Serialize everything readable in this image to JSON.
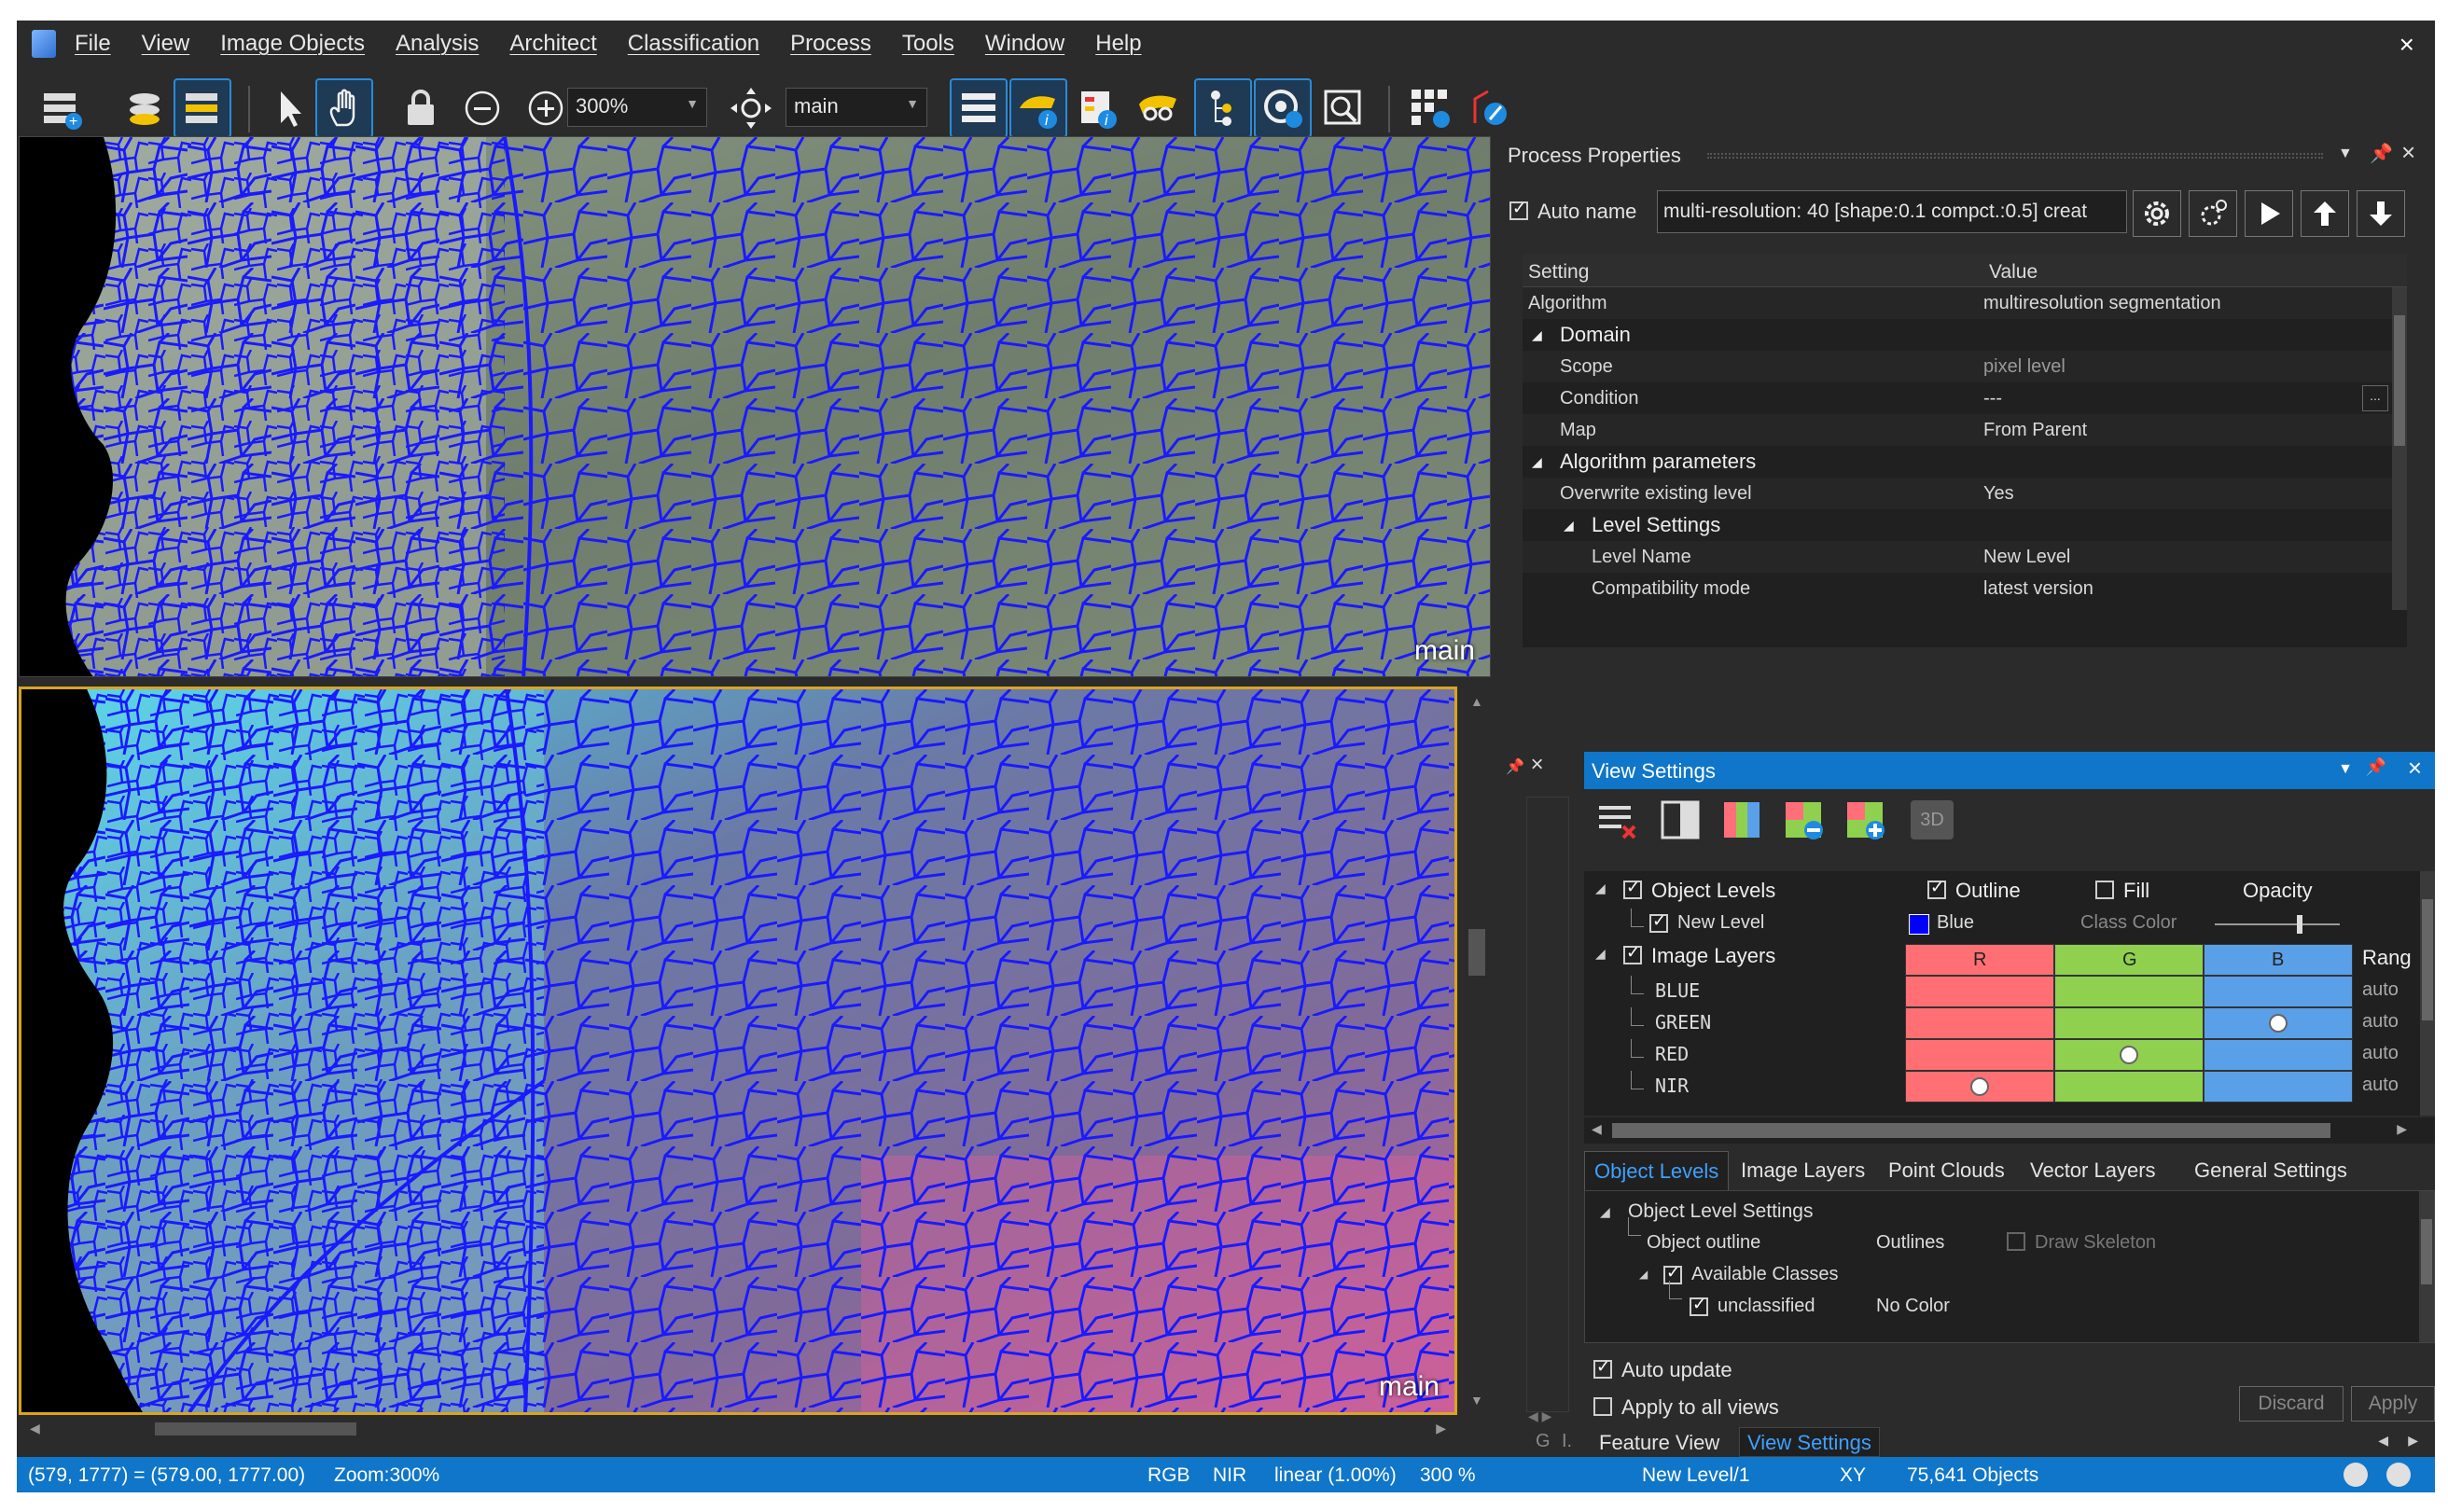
{
  "menu": [
    "File",
    "View",
    "Image Objects",
    "Analysis",
    "Architect",
    "Classification",
    "Process",
    "Tools",
    "Window",
    "Help"
  ],
  "window_close": "×",
  "toolbar": {
    "zoom": "300%",
    "map": "main"
  },
  "views": {
    "top_label": "main",
    "bottom_label": "main"
  },
  "process_properties": {
    "title": "Process Properties",
    "auto_name_label": "Auto name",
    "auto_name_checked": true,
    "name_value": "multi-resolution: 40 [shape:0.1 compct.:0.5] creat",
    "headers": [
      "Setting",
      "Value"
    ],
    "rows": [
      {
        "setting": "Algorithm",
        "value": "multiresolution segmentation"
      },
      {
        "setting": "Domain",
        "value": ""
      },
      {
        "setting": "Scope",
        "value": "pixel level"
      },
      {
        "setting": "Condition",
        "value": "---"
      },
      {
        "setting": "Map",
        "value": "From Parent"
      },
      {
        "setting": "Algorithm parameters",
        "value": ""
      },
      {
        "setting": "Overwrite existing level",
        "value": "Yes"
      },
      {
        "setting": "Level Settings",
        "value": ""
      },
      {
        "setting": "Level Name",
        "value": "New Level"
      },
      {
        "setting": "Compatibility mode",
        "value": "latest version"
      }
    ]
  },
  "view_settings": {
    "title": "View Settings",
    "btn_3d": "3D",
    "object_levels": "Object Levels",
    "outline": "Outline",
    "fill": "Fill",
    "opacity": "Opacity",
    "new_level": "New Level",
    "blue": "Blue",
    "class_color": "Class Color",
    "image_layers": "Image Layers",
    "rgb": [
      "R",
      "G",
      "B"
    ],
    "range": "Rang",
    "layers": [
      {
        "name": "BLUE",
        "range": "auto"
      },
      {
        "name": "GREEN",
        "range": "auto"
      },
      {
        "name": "RED",
        "range": "auto"
      },
      {
        "name": "NIR",
        "range": "auto"
      }
    ],
    "tabs": [
      "Object Levels",
      "Image Layers",
      "Point Clouds",
      "Vector Layers",
      "General Settings"
    ],
    "ols": {
      "title": "Object Level Settings",
      "outline_label": "Object outline",
      "outline_value": "Outlines",
      "draw_skeleton": "Draw Skeleton",
      "available_classes": "Available Classes",
      "unclassified": "unclassified",
      "no_color": "No Color"
    },
    "auto_update": "Auto update",
    "apply_all": "Apply to all views",
    "discard": "Discard",
    "apply": "Apply",
    "bottom_tabs": [
      "Feature View",
      "View Settings"
    ]
  },
  "status": {
    "coords": "(579, 1777) = (579.00, 1777.00)",
    "zoom": "Zoom:300%",
    "rgb": "RGB",
    "nir": "NIR",
    "linear": "linear (1.00%)",
    "pct": "300 %",
    "level": "New Level/1",
    "xy": "XY",
    "objects": "75,641 Objects"
  },
  "colors": {
    "accent": "#0f76c9",
    "outline": "#1a1aff",
    "active_border": "#d9a520"
  }
}
